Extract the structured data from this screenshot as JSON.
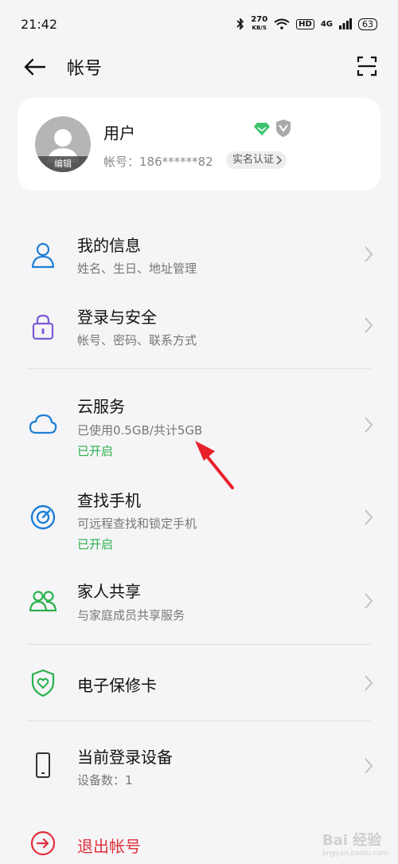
{
  "status_bar": {
    "time": "21:42",
    "speed_value": "270",
    "speed_unit": "KB/S",
    "hd": "HD",
    "network": "4G",
    "battery": "63"
  },
  "header": {
    "title": "帐号"
  },
  "profile": {
    "name": "用户",
    "avatar_edit": "编辑",
    "account": "帐号：186******82",
    "verify": "实名认证"
  },
  "menu": [
    {
      "title": "我的信息",
      "sub": "姓名、生日、地址管理"
    },
    {
      "title": "登录与安全",
      "sub": "帐号、密码、联系方式"
    },
    {
      "title": "云服务",
      "sub": "已使用0.5GB/共计5GB",
      "status": "已开启"
    },
    {
      "title": "查找手机",
      "sub": "可远程查找和锁定手机",
      "status": "已开启"
    },
    {
      "title": "家人共享",
      "sub": "与家庭成员共享服务"
    },
    {
      "title": "电子保修卡"
    },
    {
      "title": "当前登录设备",
      "sub": "设备数：1"
    },
    {
      "title": "退出帐号"
    }
  ],
  "watermark": {
    "main": "Bai 经验",
    "sub": "jingyan.baidu.com"
  },
  "colors": {
    "accent_blue": "#1f7fd6",
    "green": "#2bb24c",
    "red": "#e0303c",
    "purple": "#7b5bd6"
  }
}
